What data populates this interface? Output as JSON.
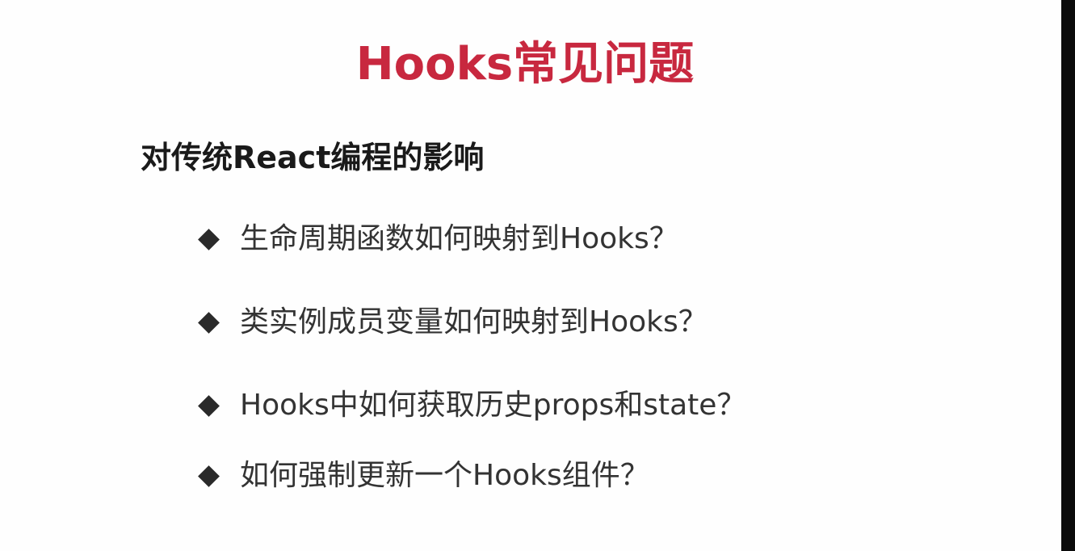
{
  "slide": {
    "title": "Hooks常见问题",
    "subtitle": "对传统React编程的影响",
    "bullets": [
      {
        "text": "生命周期函数如何映射到Hooks？",
        "icon": "diamond-bullet-icon"
      },
      {
        "text": "类实例成员变量如何映射到Hooks？",
        "icon": "diamond-bullet-icon"
      },
      {
        "text": "Hooks中如何获取历史props和state？",
        "icon": "diamond-bullet-icon"
      },
      {
        "text": "如何强制更新一个Hooks组件？",
        "icon": "diamond-bullet-icon"
      }
    ]
  },
  "colors": {
    "title": "#c8283f",
    "subtitle": "#1a1a1a",
    "bullet_text": "#333333",
    "bullet_icon": "#2a2a2a",
    "background": "#ffffff"
  }
}
